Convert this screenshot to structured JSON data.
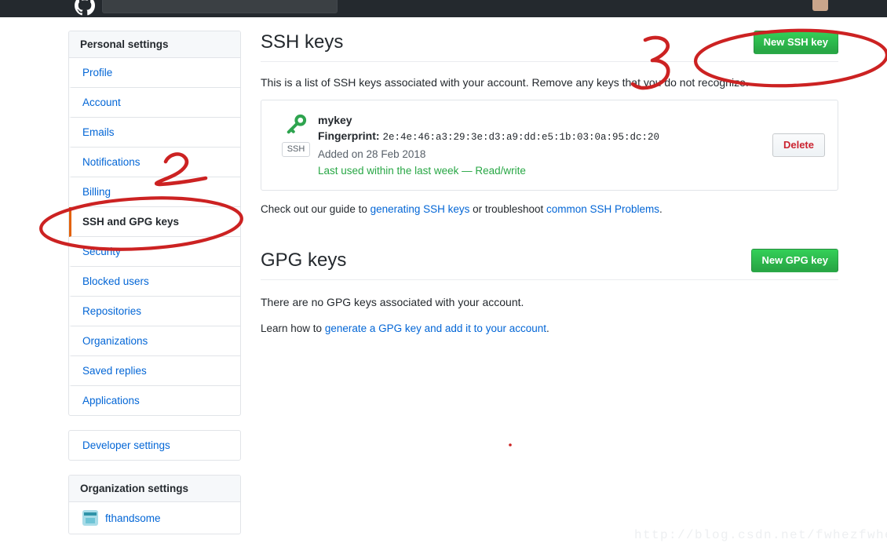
{
  "topbar": {
    "logo_icon": "github-mark-icon",
    "search_placeholder": "",
    "avatar_icon": "user-avatar-icon"
  },
  "sidebar": {
    "personal": {
      "heading": "Personal settings",
      "items": [
        {
          "label": "Profile",
          "selected": false
        },
        {
          "label": "Account",
          "selected": false
        },
        {
          "label": "Emails",
          "selected": false
        },
        {
          "label": "Notifications",
          "selected": false
        },
        {
          "label": "Billing",
          "selected": false
        },
        {
          "label": "SSH and GPG keys",
          "selected": true
        },
        {
          "label": "Security",
          "selected": false
        },
        {
          "label": "Blocked users",
          "selected": false
        },
        {
          "label": "Repositories",
          "selected": false
        },
        {
          "label": "Organizations",
          "selected": false
        },
        {
          "label": "Saved replies",
          "selected": false
        },
        {
          "label": "Applications",
          "selected": false
        }
      ]
    },
    "developer": {
      "label": "Developer settings"
    },
    "organization": {
      "heading": "Organization settings",
      "items": [
        {
          "label": "fthandsome",
          "avatar_icon": "org-avatar-icon"
        }
      ]
    }
  },
  "main": {
    "ssh": {
      "title": "SSH keys",
      "new_key_button": "New SSH key",
      "description": "This is a list of SSH keys associated with your account. Remove any keys that you do not recognize.",
      "keys": [
        {
          "name": "mykey",
          "fingerprint_label": "Fingerprint:",
          "fingerprint": "2e:4e:46:a3:29:3e:d3:a9:dd:e5:1b:03:0a:95:dc:20",
          "added": "Added on 28 Feb 2018",
          "last_used": "Last used within the last week — Read/write",
          "badge": "SSH",
          "key_icon": "key-icon",
          "delete_button": "Delete"
        }
      ],
      "footer_note": {
        "prefix": "Check out our guide to ",
        "link1": "generating SSH keys",
        "middle": " or troubleshoot ",
        "link2": "common SSH Problems",
        "suffix": "."
      }
    },
    "gpg": {
      "title": "GPG keys",
      "new_key_button": "New GPG key",
      "empty_message": "There are no GPG keys associated with your account.",
      "learn_note": {
        "prefix": "Learn how to ",
        "link": "generate a GPG key and add it to your account",
        "suffix": "."
      }
    }
  },
  "annotations": {
    "marker_two": "2",
    "marker_three": "3",
    "color": "#cc2222",
    "circle_sidebar": "ellipse-highlight-ssh-and-gpg-keys",
    "circle_new_ssh_key": "ellipse-highlight-new-ssh-key-button",
    "dot": "small-red-dot"
  },
  "watermark": {
    "text": "http://blog.csdn.net/fwhezfwhez"
  }
}
